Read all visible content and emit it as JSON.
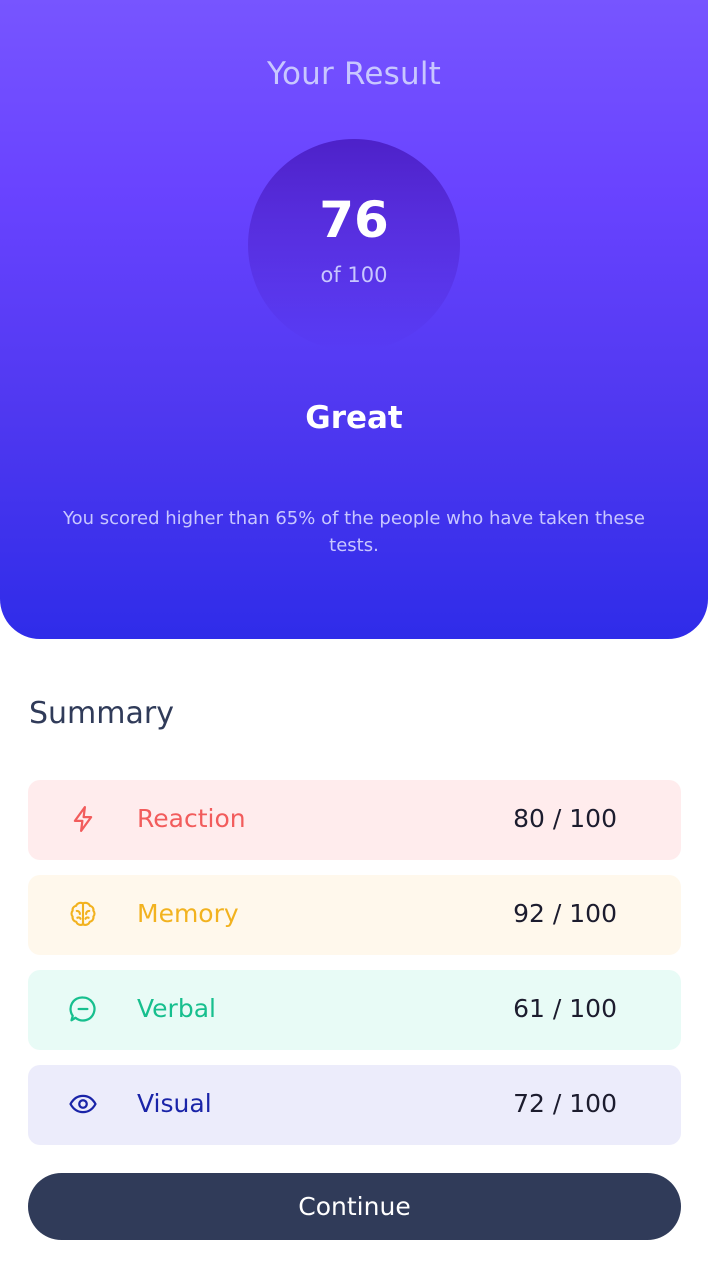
{
  "result": {
    "title": "Your Result",
    "score": "76",
    "score_max": "of 100",
    "rating": "Great",
    "description": "You scored higher than 65% of the people who have taken these tests."
  },
  "summary": {
    "title": "Summary",
    "items": [
      {
        "label": "Reaction",
        "value": "80 / 100",
        "icon": "lightning-icon",
        "color": "#f25c5c",
        "bg": "#ffeced"
      },
      {
        "label": "Memory",
        "value": "92 / 100",
        "icon": "brain-icon",
        "color": "#f2b21f",
        "bg": "#fff8ec"
      },
      {
        "label": "Verbal",
        "value": "61 / 100",
        "icon": "chat-icon",
        "color": "#17bf8e",
        "bg": "#e8fbf6"
      },
      {
        "label": "Visual",
        "value": "72 / 100",
        "icon": "eye-icon",
        "color": "#1a24a8",
        "bg": "#ececfb"
      }
    ]
  },
  "continue_label": "Continue"
}
